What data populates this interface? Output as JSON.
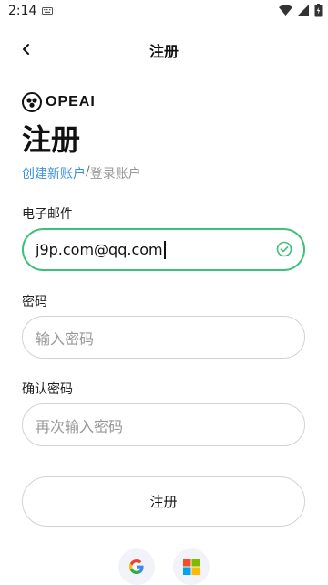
{
  "status_bar": {
    "time": "2:14"
  },
  "topbar": {
    "title": "注册"
  },
  "brand": {
    "name": "OPEAI"
  },
  "page": {
    "heading": "注册",
    "subnav_active": "创建新账户",
    "subnav_sep": "/",
    "subnav_other": "登录账户"
  },
  "form": {
    "email_label": "电子邮件",
    "email_value": "j9p.com@qq.com",
    "password_label": "密码",
    "password_placeholder": "输入密码",
    "confirm_label": "确认密码",
    "confirm_placeholder": "再次输入密码",
    "submit_label": "注册"
  },
  "colors": {
    "accent": "#3b8fe3",
    "valid": "#3ec07a"
  },
  "icons": [
    "keyboard-icon",
    "wifi-icon",
    "cellular-icon",
    "battery-icon",
    "back-arrow-icon",
    "check-circle-icon",
    "google-icon",
    "microsoft-icon"
  ]
}
